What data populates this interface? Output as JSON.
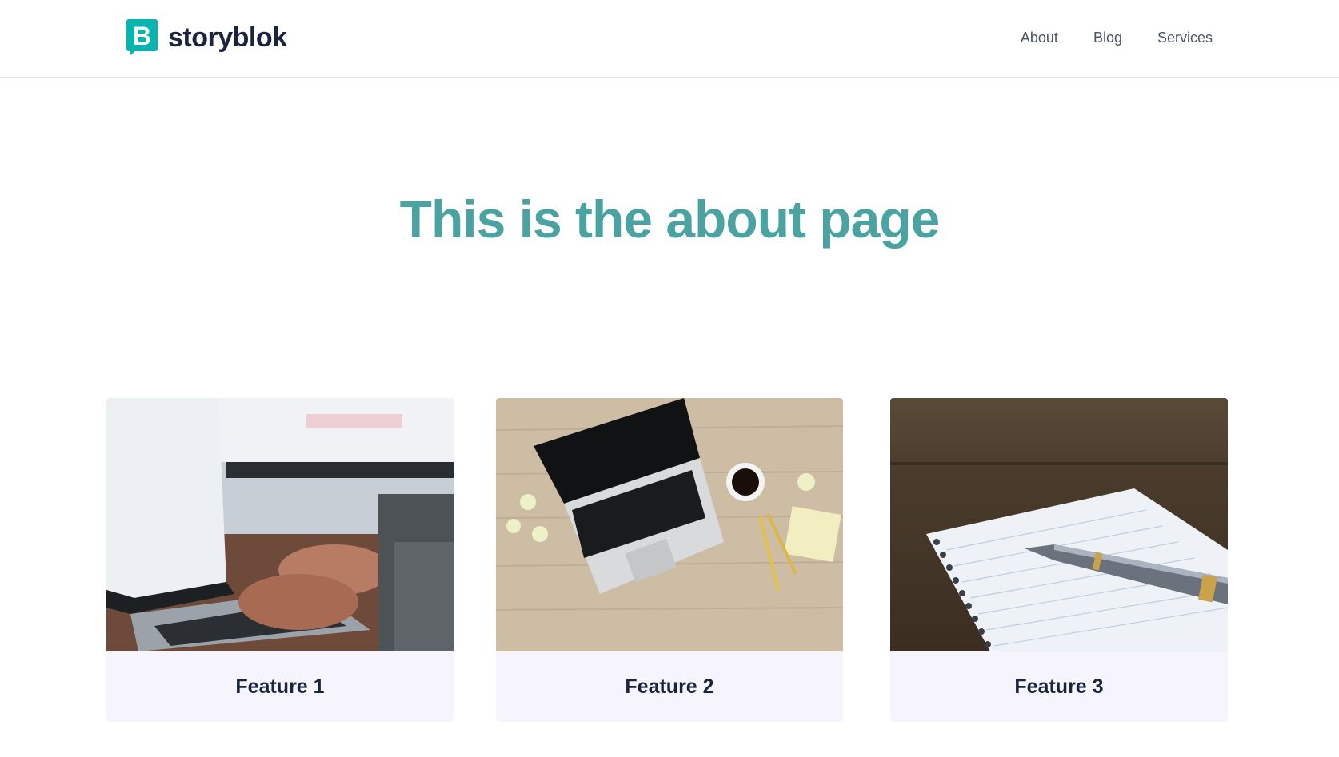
{
  "header": {
    "logo": {
      "text": "storyblok",
      "icon": "storyblok-logo-icon",
      "mark_letter": "B",
      "brand_color": "#09b3af"
    },
    "nav": [
      {
        "label": "About"
      },
      {
        "label": "Blog"
      },
      {
        "label": "Services"
      }
    ]
  },
  "hero": {
    "title": "This is the about page",
    "title_color": "#4aa3a1"
  },
  "features": [
    {
      "title": "Feature 1",
      "image": "hands-typing-on-laptop-photo"
    },
    {
      "title": "Feature 2",
      "image": "laptop-and-coffee-on-desk-photo"
    },
    {
      "title": "Feature 3",
      "image": "notebook-and-fountain-pen-photo"
    }
  ]
}
